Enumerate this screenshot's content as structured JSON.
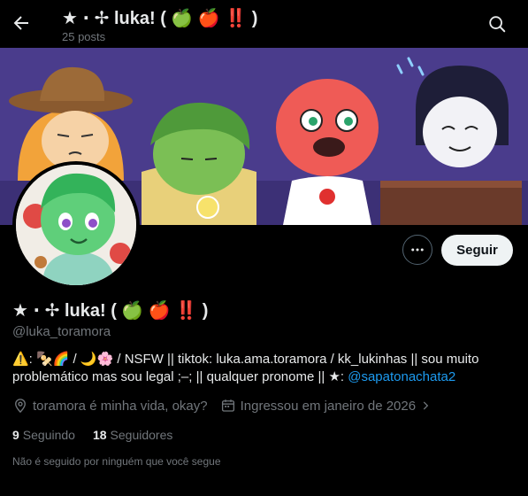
{
  "header": {
    "title": "★ ⋅ ✢ luka! ( 🍏 🍎 ‼️ )",
    "posts_count": "25 posts"
  },
  "profile": {
    "display_name": "★ ⋅ ✢ luka! ( 🍏 🍎 ‼️ )",
    "handle": "@luka_toramora",
    "bio_text": "⚠️: 🍢🌈 / 🌙🌸 / NSFW  ||  tiktok: luka.ama.toramora / kk_lukinhas  ||  sou muito problemático mas sou legal ;–;  ||  qualquer pronome  ||  ★: ",
    "bio_link": "@sapatonachata2",
    "location": "toramora é minha vida, okay?",
    "joined": "Ingressou em janeiro de 2026",
    "following_count": "9",
    "following_label": "Seguindo",
    "followers_count": "18",
    "followers_label": "Seguidores",
    "mutuals_note": "Não é seguido por ninguém que você segue"
  },
  "actions": {
    "follow_label": "Seguir"
  },
  "icons": {
    "back": "back-arrow-icon",
    "search": "search-icon",
    "more": "more-dots-icon",
    "location": "location-pin-icon",
    "calendar": "calendar-icon",
    "chevron": "chevron-right-icon"
  },
  "colors": {
    "background": "#000000",
    "text": "#e7e9ea",
    "muted": "#71767b",
    "link": "#1d9bf0",
    "follow_bg": "#eff3f4",
    "banner_bg": "#4a3c8c"
  }
}
